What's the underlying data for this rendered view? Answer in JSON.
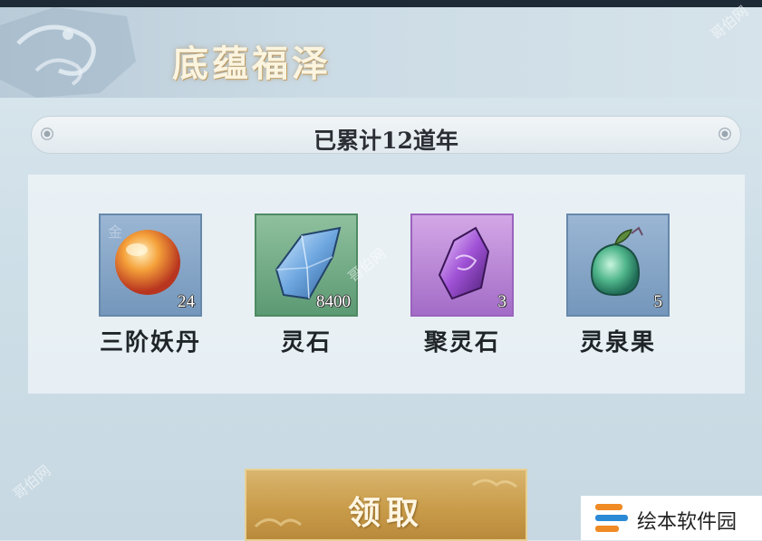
{
  "window": {
    "title": "底蕴福泽"
  },
  "counter": {
    "text": "已累计12道年"
  },
  "rewards": [
    {
      "name": "三阶妖丹",
      "quantity": "24",
      "icon": "demon-core-icon",
      "rarity_color": "#7497bb"
    },
    {
      "name": "灵石",
      "quantity": "8400",
      "icon": "spirit-stone-icon",
      "rarity_color": "#5c9a73"
    },
    {
      "name": "聚灵石",
      "quantity": "3",
      "icon": "gathering-spirit-stone-icon",
      "rarity_color": "#a36cc7"
    },
    {
      "name": "灵泉果",
      "quantity": "5",
      "icon": "spirit-spring-fruit-icon",
      "rarity_color": "#7497bb"
    }
  ],
  "claim_button": {
    "label": "领取"
  },
  "watermark": {
    "badge_text": "绘本软件园",
    "overlay_text": "哥伯网"
  },
  "colors": {
    "accent_gold": "#c99c4a",
    "title_text": "#fbf4df"
  }
}
